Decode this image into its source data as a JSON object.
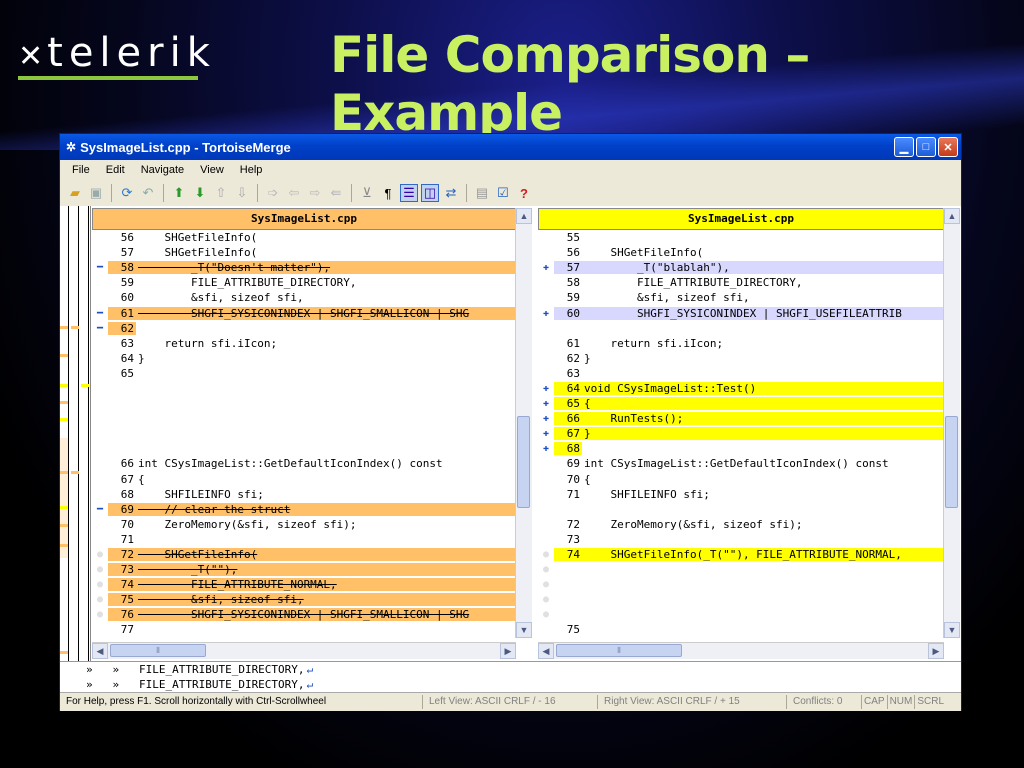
{
  "colors": {
    "removed": "#ffc068",
    "removed_strong": "#d97060",
    "added": "#ffff00",
    "added_weak": "#ffff88",
    "changed": "#d8d8ff",
    "empty": "#cccccc",
    "title_green": "#c8f060",
    "logo_line": "#8dc63f"
  },
  "slide": {
    "logo": "telerik",
    "title": "File Comparison – Example"
  },
  "window": {
    "title": "SysImageList.cpp - TortoiseMerge",
    "menu": [
      "File",
      "Edit",
      "Navigate",
      "View",
      "Help"
    ],
    "toolbar_icons": [
      "open-icon",
      "save-icon",
      "reload-icon",
      "undo-icon",
      "next-difference-icon",
      "previous-difference-icon",
      "next-conflict-icon",
      "previous-conflict-icon",
      "use-left-icon",
      "use-right-icon",
      "use-both-icon",
      "use-block-icon",
      "whitespace-icon",
      "pilcrow-icon",
      "one-pane-icon",
      "two-pane-icon",
      "switch-icon",
      "patch-icon",
      "settings-icon",
      "help-icon"
    ]
  },
  "left_pane": {
    "header": "SysImageList.cpp",
    "lines": [
      {
        "n": "56",
        "t": "    SHGetFileInfo(",
        "s": "normal",
        "g": ""
      },
      {
        "n": "57",
        "t": "    SHGetFileInfo(",
        "s": "normal",
        "g": ""
      },
      {
        "n": "58",
        "t": "        _T(\"Doesn't matter\"),",
        "s": "removed",
        "g": "minus"
      },
      {
        "n": "59",
        "t": "        FILE_ATTRIBUTE_DIRECTORY,",
        "s": "normal",
        "g": ""
      },
      {
        "n": "60",
        "t": "        &sfi, sizeof sfi,",
        "s": "normal",
        "g": ""
      },
      {
        "n": "61",
        "t": "        SHGFI_SYSICONINDEX | SHGFI_SMALLICON | SHG",
        "s": "removed",
        "g": "minus"
      },
      {
        "n": "62",
        "t": "",
        "s": "removed",
        "g": "minus"
      },
      {
        "n": "63",
        "t": "    return sfi.iIcon;",
        "s": "normal",
        "g": ""
      },
      {
        "n": "64",
        "t": "}",
        "s": "normal",
        "g": ""
      },
      {
        "n": "65",
        "t": "",
        "s": "normal",
        "g": ""
      },
      {
        "n": "",
        "t": "",
        "s": "empty",
        "g": ""
      },
      {
        "n": "",
        "t": "",
        "s": "empty",
        "g": ""
      },
      {
        "n": "",
        "t": "",
        "s": "empty",
        "g": ""
      },
      {
        "n": "",
        "t": "",
        "s": "empty",
        "g": ""
      },
      {
        "n": "",
        "t": "",
        "s": "empty",
        "g": ""
      },
      {
        "n": "66",
        "t": "int CSysImageList::GetDefaultIconIndex() const",
        "s": "normal",
        "g": ""
      },
      {
        "n": "67",
        "t": "{",
        "s": "normal",
        "g": ""
      },
      {
        "n": "68",
        "t": "    SHFILEINFO sfi;",
        "s": "normal",
        "g": ""
      },
      {
        "n": "69",
        "t": "    // clear the struct",
        "s": "removed",
        "g": "minus"
      },
      {
        "n": "70",
        "t": "    ZeroMemory(&sfi, sizeof sfi);",
        "s": "normal",
        "g": ""
      },
      {
        "n": "71",
        "t": "",
        "s": "normal",
        "g": ""
      },
      {
        "n": "72",
        "t": "    SHGetFileInfo(",
        "s": "removed",
        "g": "circle"
      },
      {
        "n": "73",
        "t": "        _T(\"\"),",
        "s": "removed",
        "g": "circle"
      },
      {
        "n": "74",
        "t": "        FILE_ATTRIBUTE_NORMAL,",
        "s": "removed",
        "g": "circle"
      },
      {
        "n": "75",
        "t": "        &sfi, sizeof sfi,",
        "s": "removed",
        "g": "circle"
      },
      {
        "n": "76",
        "t": "        SHGFI_SYSICONINDEX | SHGFI_SMALLICON | SHG",
        "s": "removed",
        "g": "circle"
      },
      {
        "n": "77",
        "t": "",
        "s": "normal",
        "g": ""
      }
    ]
  },
  "right_pane": {
    "header": "SysImageList.cpp",
    "lines": [
      {
        "n": "55",
        "t": "",
        "s": "normal",
        "g": ""
      },
      {
        "n": "56",
        "t": "    SHGetFileInfo(",
        "s": "normal",
        "g": ""
      },
      {
        "n": "57",
        "t": "        _T(\"blablah\"),",
        "s": "changed",
        "g": "plus"
      },
      {
        "n": "58",
        "t": "        FILE_ATTRIBUTE_DIRECTORY,",
        "s": "normal",
        "g": ""
      },
      {
        "n": "59",
        "t": "        &sfi, sizeof sfi,",
        "s": "normal",
        "g": ""
      },
      {
        "n": "60",
        "t": "        SHGFI_SYSICONINDEX | SHGFI_USEFILEATTRIB",
        "s": "changed",
        "g": "plus"
      },
      {
        "n": "",
        "t": "",
        "s": "empty",
        "g": ""
      },
      {
        "n": "61",
        "t": "    return sfi.iIcon;",
        "s": "normal",
        "g": ""
      },
      {
        "n": "62",
        "t": "}",
        "s": "normal",
        "g": ""
      },
      {
        "n": "63",
        "t": "",
        "s": "normal",
        "g": ""
      },
      {
        "n": "64",
        "t": "void CSysImageList::Test()",
        "s": "added",
        "g": "plus"
      },
      {
        "n": "65",
        "t": "{",
        "s": "added",
        "g": "plus"
      },
      {
        "n": "66",
        "t": "    RunTests();",
        "s": "added",
        "g": "plus"
      },
      {
        "n": "67",
        "t": "}",
        "s": "added",
        "g": "plus"
      },
      {
        "n": "68",
        "t": "",
        "s": "added",
        "g": "plus"
      },
      {
        "n": "69",
        "t": "int CSysImageList::GetDefaultIconIndex() const",
        "s": "normal",
        "g": ""
      },
      {
        "n": "70",
        "t": "{",
        "s": "normal",
        "g": ""
      },
      {
        "n": "71",
        "t": "    SHFILEINFO sfi;",
        "s": "normal",
        "g": ""
      },
      {
        "n": "",
        "t": "",
        "s": "empty",
        "g": ""
      },
      {
        "n": "72",
        "t": "    ZeroMemory(&sfi, sizeof sfi);",
        "s": "normal",
        "g": ""
      },
      {
        "n": "73",
        "t": "",
        "s": "normal",
        "g": ""
      },
      {
        "n": "74",
        "t": "    SHGetFileInfo(_T(\"\"), FILE_ATTRIBUTE_NORMAL,",
        "s": "added",
        "g": "circle"
      },
      {
        "n": "",
        "t": "",
        "s": "empty",
        "g": "circle"
      },
      {
        "n": "",
        "t": "",
        "s": "empty",
        "g": "circle"
      },
      {
        "n": "",
        "t": "",
        "s": "empty",
        "g": "circle"
      },
      {
        "n": "",
        "t": "",
        "s": "empty",
        "g": "circle"
      },
      {
        "n": "75",
        "t": "",
        "s": "normal",
        "g": ""
      }
    ]
  },
  "bottom_pane": {
    "lines": [
      "»   »   FILE_ATTRIBUTE_DIRECTORY,",
      "»   »   FILE_ATTRIBUTE_DIRECTORY,"
    ]
  },
  "statusbar": {
    "help": "For Help, press F1. Scroll horizontally with Ctrl-Scrollwheel",
    "left_view": "Left View: ASCII CRLF  / - 16",
    "right_view": "Right View: ASCII CRLF  / + 15",
    "conflicts": "Conflicts: 0",
    "cap": "CAP",
    "num": "NUM",
    "scrl": "SCRL"
  }
}
